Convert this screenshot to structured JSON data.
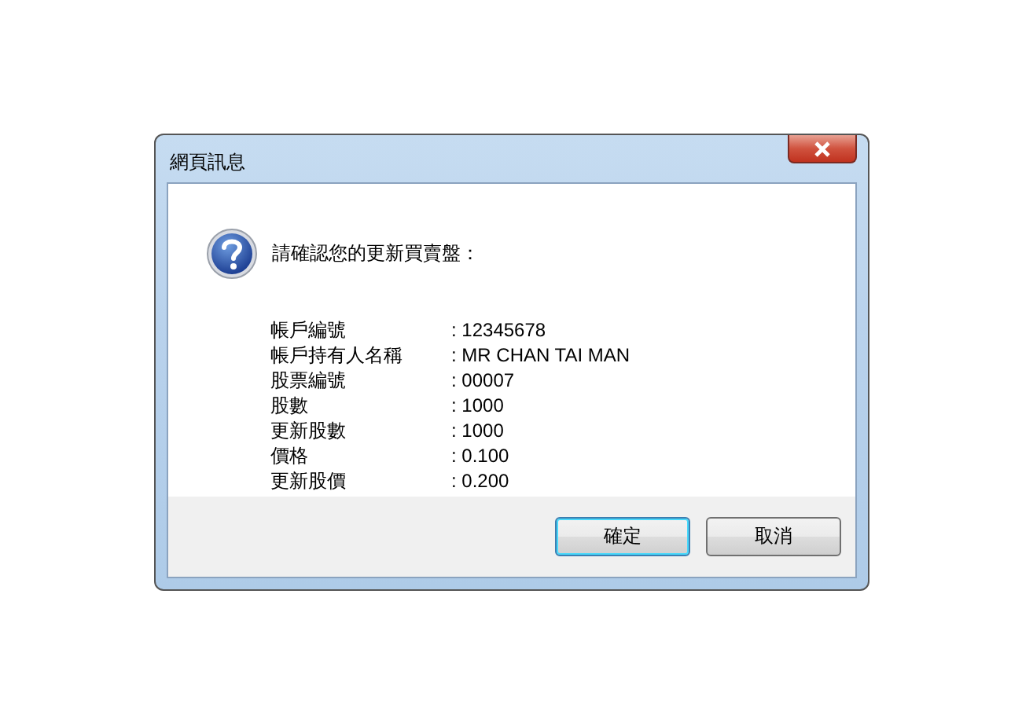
{
  "window": {
    "title": "網頁訊息"
  },
  "message": "請確認您的更新買賣盤：",
  "fields": [
    {
      "label": "帳戶編號",
      "value": ": 12345678"
    },
    {
      "label": "帳戶持有人名稱",
      "value": ":  MR CHAN TAI MAN"
    },
    {
      "label": "股票編號",
      "value": ": 00007"
    },
    {
      "label": "股數",
      "value": ": 1000"
    },
    {
      "label": "更新股數",
      "value": ": 1000"
    },
    {
      "label": "價格",
      "value": ": 0.100"
    },
    {
      "label": "更新股價",
      "value": ": 0.200"
    }
  ],
  "buttons": [
    {
      "label": "確定",
      "default": true
    },
    {
      "label": "取消",
      "default": false
    }
  ]
}
